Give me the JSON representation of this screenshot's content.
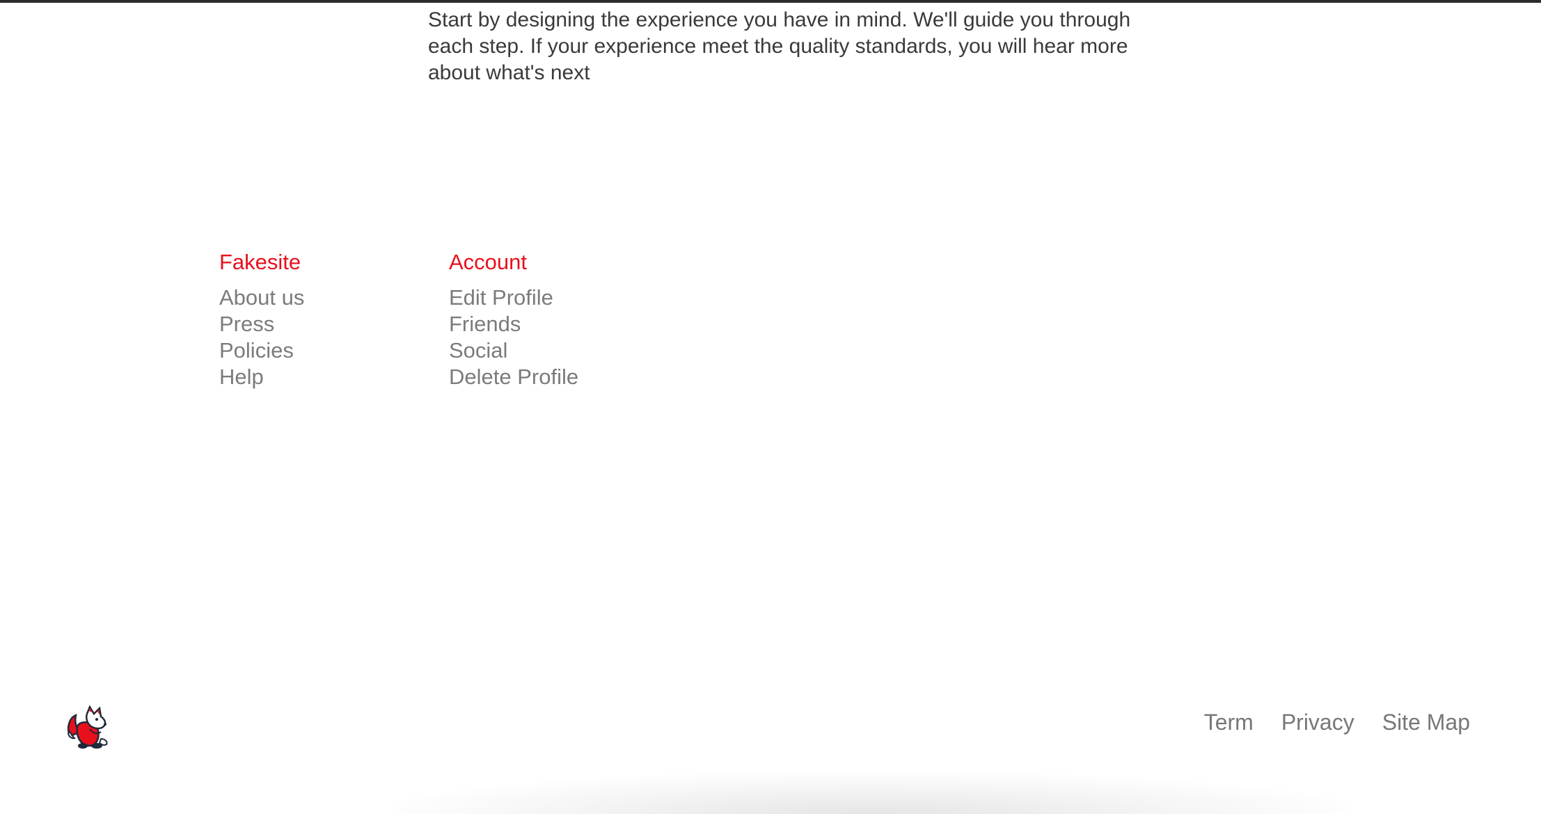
{
  "intro": {
    "text": "Start by designing the experience you have in mind. We'll guide you through each step. If your experience meet the quality standards, you will hear more about what's next"
  },
  "footer": {
    "columns": [
      {
        "heading": "Fakesite",
        "links": [
          "About us",
          "Press",
          "Policies",
          "Help"
        ]
      },
      {
        "heading": "Account",
        "links": [
          "Edit Profile",
          "Friends",
          "Social",
          "Delete Profile"
        ]
      }
    ],
    "legal_links": [
      "Term",
      "Privacy",
      "Site Map"
    ],
    "logo_icon": "fox-logo-icon"
  },
  "colors": {
    "accent": "#e8101c",
    "link": "#7b7b7b",
    "text": "#3a3a3a",
    "top_border": "#2b2b2b"
  }
}
